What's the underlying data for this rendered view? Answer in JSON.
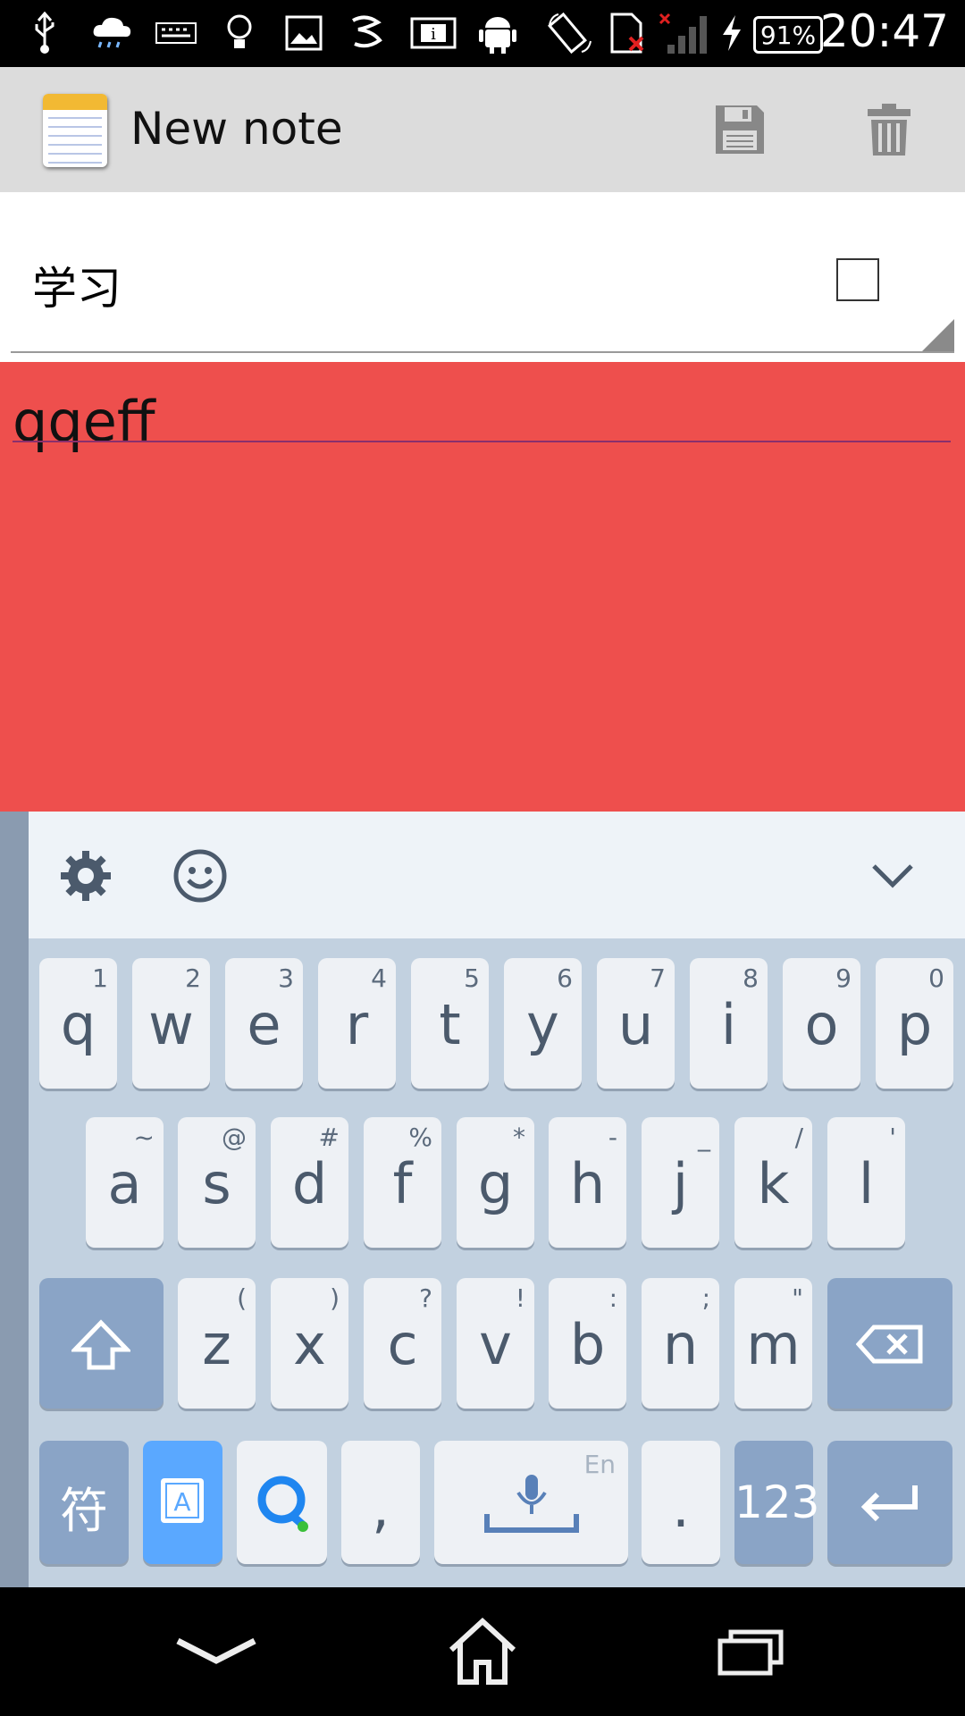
{
  "status_bar": {
    "time": "20:47",
    "battery": "91%",
    "icons": [
      "usb-icon",
      "cloud-rain-icon",
      "keyboard-icon",
      "lightbulb-icon",
      "image-icon",
      "app-icon",
      "info-card-icon",
      "android-icon",
      "rotate-icon",
      "no-sim-icon",
      "no-signal-icon",
      "charging-icon",
      "battery-icon"
    ]
  },
  "action_bar": {
    "title": "New note",
    "save_label": "save",
    "delete_label": "delete"
  },
  "category": {
    "label": "学习",
    "checked": false
  },
  "note": {
    "text": "qqeff",
    "background_color": "#ee4f4d"
  },
  "keyboard": {
    "toolbar": [
      "gear-icon",
      "emoji-icon",
      "collapse-chevron-icon"
    ],
    "row1": [
      {
        "k": "q",
        "s": "1"
      },
      {
        "k": "w",
        "s": "2"
      },
      {
        "k": "e",
        "s": "3"
      },
      {
        "k": "r",
        "s": "4"
      },
      {
        "k": "t",
        "s": "5"
      },
      {
        "k": "y",
        "s": "6"
      },
      {
        "k": "u",
        "s": "7"
      },
      {
        "k": "i",
        "s": "8"
      },
      {
        "k": "o",
        "s": "9"
      },
      {
        "k": "p",
        "s": "0"
      }
    ],
    "row2": [
      {
        "k": "a",
        "s": "~"
      },
      {
        "k": "s",
        "s": "@"
      },
      {
        "k": "d",
        "s": "#"
      },
      {
        "k": "f",
        "s": "%"
      },
      {
        "k": "g",
        "s": "*"
      },
      {
        "k": "h",
        "s": "-"
      },
      {
        "k": "j",
        "s": "_"
      },
      {
        "k": "k",
        "s": "/"
      },
      {
        "k": "l",
        "s": "'"
      }
    ],
    "row3": [
      {
        "k": "z",
        "s": "("
      },
      {
        "k": "x",
        "s": ")"
      },
      {
        "k": "c",
        "s": "?"
      },
      {
        "k": "v",
        "s": "!"
      },
      {
        "k": "b",
        "s": ":"
      },
      {
        "k": "n",
        "s": ";"
      },
      {
        "k": "m",
        "s": "\""
      }
    ],
    "symbols_key": "符",
    "comma": ",",
    "period": ".",
    "numbers_key": "123",
    "space_lang": "En"
  }
}
